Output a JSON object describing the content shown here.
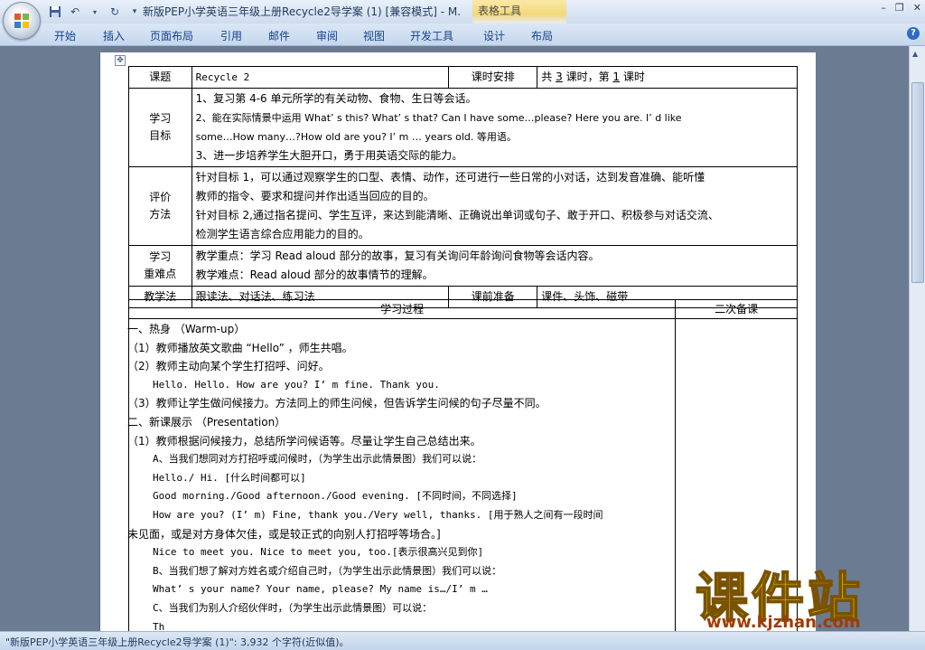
{
  "window": {
    "title": "新版PEP小学英语三年级上册Recycle2导学案 (1) [兼容模式] - M.",
    "contextual_tab": "表格工具",
    "controls": [
      "–",
      "❐",
      "✕"
    ]
  },
  "ribbon": {
    "tabs": [
      "开始",
      "插入",
      "页面布局",
      "引用",
      "邮件",
      "审阅",
      "视图",
      "开发工具",
      "设计",
      "布局"
    ]
  },
  "header_table": {
    "r1": {
      "label": "课题",
      "topic": "Recycle 2",
      "time_label": "课时安排",
      "time_prefix": "共",
      "time_total": "3",
      "time_mid": "课时，第",
      "time_current": "1",
      "time_suffix": "课时"
    },
    "goals": {
      "label_a": "学习",
      "label_b": "目标",
      "lines": [
        "1、复习第 4-6 单元所学的有关动物、食物、生日等会话。",
        "2、能在实际情景中运用 What’ s this? What’ s that? Can I have some…please? Here you are. I’ d like",
        "some…How many…?How old are you? I’ m … years old. 等用语。",
        "3、进一步培养学生大胆开口，勇于用英语交际的能力。"
      ]
    },
    "eval": {
      "label_a": "评价",
      "label_b": "方法",
      "lines": [
        "针对目标 1，可以通过观察学生的口型、表情、动作，还可进行一些日常的小对话，达到发音准确、能听懂",
        "教师的指令、要求和提问并作出适当回应的目的。",
        "针对目标 2,通过指名提问、学生互评，来达到能清晰、正确说出单词或句子、敢于开口、积极参与对话交流、",
        "检测学生语言综合应用能力的目的。"
      ]
    },
    "key": {
      "label_a": "学习",
      "label_b": "重难点",
      "lines": [
        "教学重点：学习 Read aloud 部分的故事，复习有关询问年龄询问食物等会话内容。",
        "教学难点：Read aloud 部分的故事情节的理解。"
      ]
    },
    "method": {
      "label": "教学法",
      "value": "跟读法、对话法、练习法",
      "prep_label": "课前准备",
      "prep_value": "课件、头饰、磁带"
    }
  },
  "process_table": {
    "header_left": "学习过程",
    "header_right": "二次备课",
    "lines": [
      {
        "text": "一、热身 （Warm-up）",
        "indent": false
      },
      {
        "text": "（1）教师播放英文歌曲 “Hello” ，师生共唱。",
        "indent": false
      },
      {
        "text": "（2）教师主动向某个学生打招呼、问好。",
        "indent": false
      },
      {
        "text": "Hello. Hello. How are you? I’ m fine. Thank you.",
        "indent": true
      },
      {
        "text": "（3）教师让学生做问候接力。方法同上的师生问候，但告诉学生问候的句子尽量不同。",
        "indent": false
      },
      {
        "text": "二、新课展示 （Presentation）",
        "indent": false
      },
      {
        "text": "（1）教师根据问候接力，总结所学问候语等。尽量让学生自己总结出来。",
        "indent": false
      },
      {
        "text": "A、当我们想同对方打招呼或问候时，（为学生出示此情景图）我们可以说：",
        "indent": true
      },
      {
        "text": "Hello./ Hi. [什么时间都可以]",
        "indent": true
      },
      {
        "text": "Good morning./Good afternoon./Good evening.   [不同时间，不同选择]",
        "indent": true
      },
      {
        "text": "How are you? (I’ m) Fine, thank you./Very well, thanks.  [用于熟人之间有一段时间",
        "indent": true
      },
      {
        "text": "未见面，或是对方身体欠佳，或是较正式的向别人打招呼等场合。]",
        "indent": false
      },
      {
        "text": "Nice to meet you. Nice to meet you, too.[表示很高兴见到你]",
        "indent": true
      },
      {
        "text": "B、当我们想了解对方姓名或介绍自己时，（为学生出示此情景图）我们可以说：",
        "indent": true
      },
      {
        "text": "What’ s your name? Your name, please?  My name is…/I’ m …",
        "indent": true
      },
      {
        "text": "C、当我们为别人介绍伙伴时，（为学生出示此情景图）可以说：",
        "indent": true
      },
      {
        "text": "Th",
        "indent": true
      }
    ]
  },
  "status": {
    "text": "\"新版PEP小学英语三年级上册Recycle2导学案 (1)\": 3,932 个字符(近似值)。"
  },
  "watermark": {
    "brand": "课件站",
    "url": "www.kjzhan.com"
  }
}
